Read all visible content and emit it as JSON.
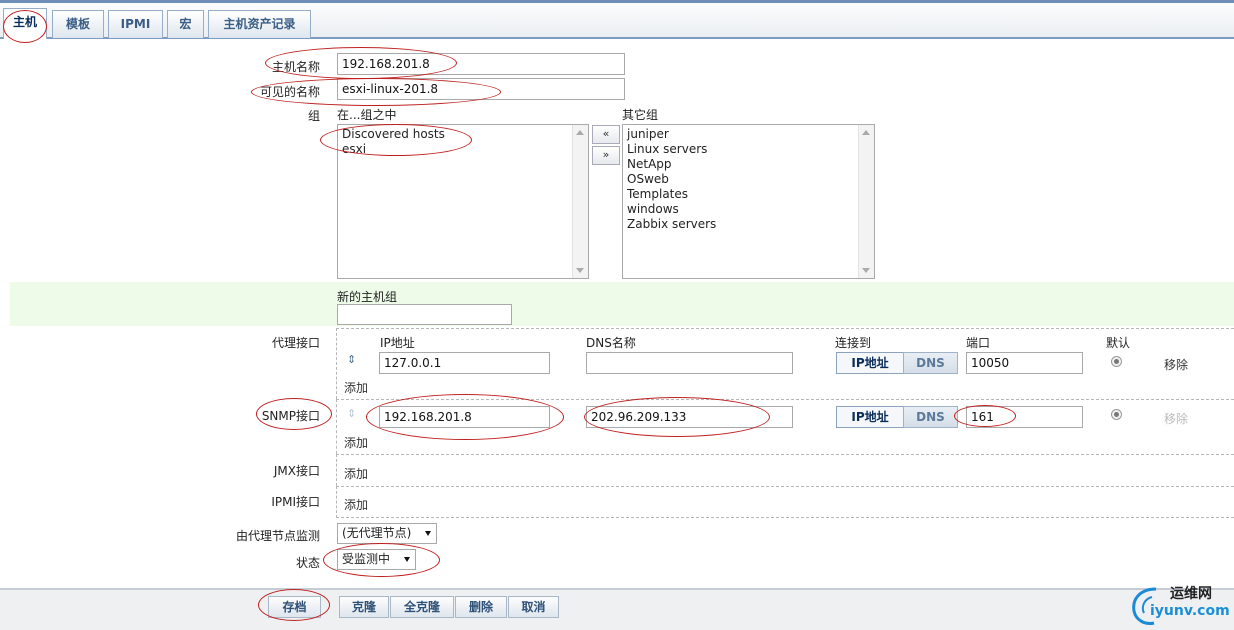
{
  "tabs": [
    {
      "label": "主机"
    },
    {
      "label": "模板"
    },
    {
      "label": "IPMI"
    },
    {
      "label": "宏"
    },
    {
      "label": "主机资产记录"
    }
  ],
  "form": {
    "hostname_label": "主机名称",
    "hostname_value": "192.168.201.8",
    "visible_name_label": "可见的名称",
    "visible_name_value": "esxi-linux-201.8",
    "groups_label": "组",
    "in_groups_label": "在...组之中",
    "other_groups_label": "其它组",
    "in_groups": [
      "Discovered hosts",
      "esxi"
    ],
    "other_groups": [
      "juniper",
      "Linux servers",
      "NetApp",
      "OSweb",
      "Templates",
      "windows",
      "Zabbix servers"
    ],
    "move_left": "«",
    "move_right": "»",
    "new_group_label": "新的主机组",
    "new_group_value": ""
  },
  "interfaces": {
    "col_ip": "IP地址",
    "col_dns": "DNS名称",
    "col_connect": "连接到",
    "col_port": "端口",
    "col_default": "默认",
    "btn_ip": "IP地址",
    "btn_dns": "DNS",
    "remove": "移除",
    "add": "添加",
    "agent": {
      "label": "代理接口",
      "ip": "127.0.0.1",
      "dns": "",
      "port": "10050"
    },
    "snmp": {
      "label": "SNMP接口",
      "ip": "192.168.201.8",
      "dns": "202.96.209.133",
      "port": "161"
    },
    "jmx": {
      "label": "JMX接口"
    },
    "ipmi": {
      "label": "IPMI接口"
    }
  },
  "proxy": {
    "label": "由代理节点监测",
    "value": "(无代理节点)"
  },
  "status": {
    "label": "状态",
    "value": "受监测中"
  },
  "footer": {
    "save": "存档",
    "clone": "克隆",
    "full_clone": "全克隆",
    "delete": "删除",
    "cancel": "取消"
  },
  "watermark": {
    "line1": "运维网",
    "line2": "iyunv.com"
  },
  "colors": {
    "tab_border": "#6f8fb7",
    "annotation": "#c02020",
    "green_band": "#eefbe8"
  }
}
